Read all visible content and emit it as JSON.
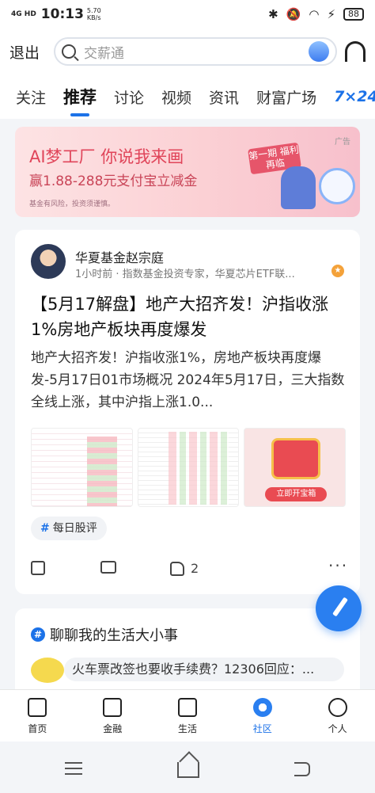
{
  "status_bar": {
    "network": "4G HD",
    "time": "10:13",
    "speed": "5.70",
    "speed_unit": "KB/s",
    "battery": "88"
  },
  "top_bar": {
    "exit_label": "退出",
    "search_placeholder": "交薪通"
  },
  "tabs": [
    "关注",
    "推荐",
    "讨论",
    "视频",
    "资讯",
    "财富广场",
    "7×24"
  ],
  "active_tab": "推荐",
  "banner": {
    "line1": "AI梦工厂  你说我来画",
    "line2": "赢1.88-288元支付宝立减金",
    "disclaimer": "基金有风险，投资须谨慎。",
    "ad_label": "广告",
    "badge": "第一期 福利再临"
  },
  "post": {
    "author": "华夏基金赵宗庭",
    "meta": "1小时前 · 指数基金投资专家，华夏芯片ETF联...",
    "title": "【5月17解盘】地产大招齐发！沪指收涨1%房地产板块再度爆发",
    "summary": "地产大招齐发！沪指收涨1%，房地产板块再度爆发-5月17日01市场概况 2024年5月17日，三大指数全线上涨，其中沪指上涨1.0...",
    "promo_button": "立即开宝箱",
    "tag": "每日股评",
    "likes": "2"
  },
  "topic_card": {
    "topic": "聊聊我的生活大小事",
    "bubble": "火车票改签也要收手续费？12306回应：..."
  },
  "bottom_nav": [
    {
      "label": "首页",
      "icon": "home-icon"
    },
    {
      "label": "金融",
      "icon": "finance-icon"
    },
    {
      "label": "生活",
      "icon": "shopping-bag-icon"
    },
    {
      "label": "社区",
      "icon": "community-icon"
    },
    {
      "label": "个人",
      "icon": "profile-icon"
    }
  ],
  "accent_color": "#1c72e8"
}
